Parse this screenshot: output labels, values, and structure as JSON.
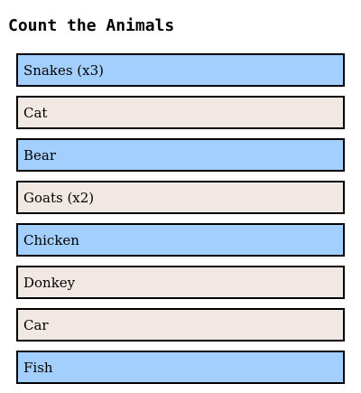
{
  "title": "Count the Animals",
  "colors": {
    "blue": "#a3cffe",
    "beige": "#f2e8e3",
    "border": "#000000"
  },
  "items": [
    {
      "label": "Snakes (x3)",
      "color": "blue"
    },
    {
      "label": "Cat",
      "color": "beige"
    },
    {
      "label": "Bear",
      "color": "blue"
    },
    {
      "label": "Goats (x2)",
      "color": "beige"
    },
    {
      "label": "Chicken",
      "color": "blue"
    },
    {
      "label": "Donkey",
      "color": "beige"
    },
    {
      "label": "Car",
      "color": "beige"
    },
    {
      "label": "Fish",
      "color": "blue"
    }
  ]
}
